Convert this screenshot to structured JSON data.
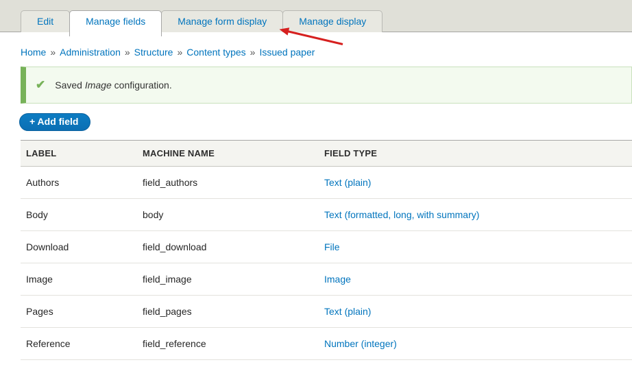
{
  "tabs": {
    "items": [
      {
        "label": "Edit",
        "active": false
      },
      {
        "label": "Manage fields",
        "active": true
      },
      {
        "label": "Manage form display",
        "active": false
      },
      {
        "label": "Manage display",
        "active": false
      }
    ]
  },
  "breadcrumb": {
    "separator": "»",
    "items": [
      {
        "label": "Home"
      },
      {
        "label": "Administration"
      },
      {
        "label": "Structure"
      },
      {
        "label": "Content types"
      },
      {
        "label": "Issued paper"
      }
    ]
  },
  "status_message": {
    "icon": "checkmark-icon",
    "checkmark": "✔",
    "prefix": "Saved ",
    "emphasis": "Image",
    "suffix": " configuration."
  },
  "toolbar": {
    "add_field_label": "+ Add field"
  },
  "fields_table": {
    "headers": {
      "label": "Label",
      "machine_name": "Machine name",
      "field_type": "Field type"
    },
    "rows": [
      {
        "label": "Authors",
        "machine_name": "field_authors",
        "field_type": "Text (plain)"
      },
      {
        "label": "Body",
        "machine_name": "body",
        "field_type": "Text (formatted, long, with summary)"
      },
      {
        "label": "Download",
        "machine_name": "field_download",
        "field_type": "File"
      },
      {
        "label": "Image",
        "machine_name": "field_image",
        "field_type": "Image"
      },
      {
        "label": "Pages",
        "machine_name": "field_pages",
        "field_type": "Text (plain)"
      },
      {
        "label": "Reference",
        "machine_name": "field_reference",
        "field_type": "Number (integer)"
      }
    ]
  },
  "annotation": {
    "arrow_color": "#d6201f",
    "target": "Manage form display tab"
  },
  "colors": {
    "link_blue": "#0074bd",
    "tabbar_gray": "#e0e0d8",
    "status_green_border": "#77b259",
    "status_green_bg": "#f3faef",
    "button_blue": "#0b6fb4"
  }
}
